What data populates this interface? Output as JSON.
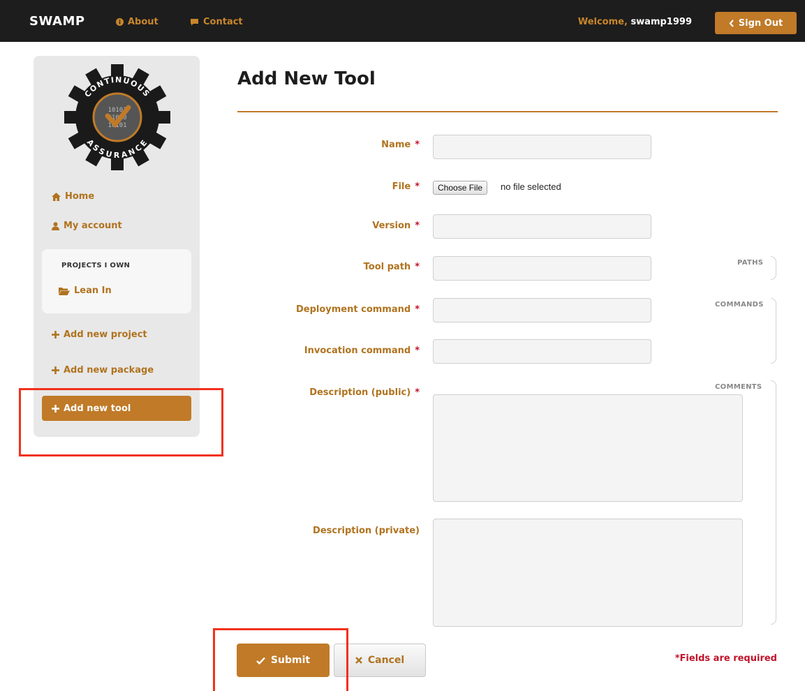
{
  "header": {
    "brand": "SWAMP",
    "nav": [
      {
        "label": "About",
        "icon": "info-circle-icon"
      },
      {
        "label": "Contact",
        "icon": "comment-icon"
      }
    ],
    "welcome_prefix": "Welcome,",
    "username": "swamp1999",
    "sign_out_label": "Sign Out"
  },
  "sidebar": {
    "logo_top_text": "CONTINUOUS",
    "logo_bottom_text": "ASSURANCE",
    "home_label": "Home",
    "account_label": "My account",
    "projects_heading": "PROJECTS I OWN",
    "projects": [
      "Lean In"
    ],
    "add_project_label": "Add new project",
    "add_package_label": "Add new package",
    "add_tool_label": "Add new tool"
  },
  "main": {
    "title": "Add New Tool",
    "fields": {
      "name": "Name",
      "file": "File",
      "version": "Version",
      "tool_path": "Tool path",
      "deployment_command": "Deployment command",
      "invocation_command": "Invocation command",
      "description_public": "Description (public)",
      "description_private": "Description (private)"
    },
    "required_mark": "*",
    "file_button": "Choose File",
    "file_status": "no file selected",
    "sections": {
      "paths": "PATHS",
      "commands": "COMMANDS",
      "comments": "COMMENTS"
    },
    "submit_label": "Submit",
    "cancel_label": "Cancel",
    "required_note": "*Fields are required"
  },
  "colors": {
    "accent": "#c07a28",
    "topbar": "#1d1d1d",
    "required": "#c0142b",
    "highlight": "#f2311d"
  }
}
